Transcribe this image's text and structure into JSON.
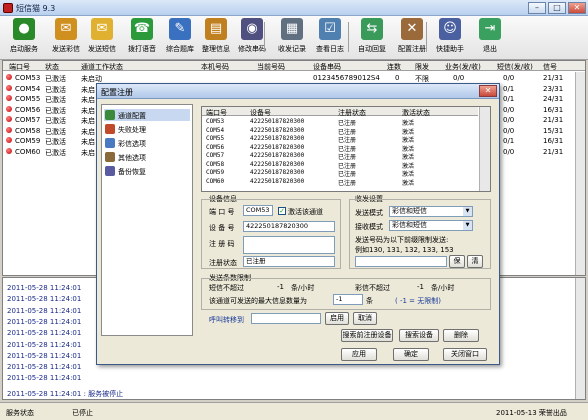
{
  "window": {
    "title": "短信猫 9.3"
  },
  "toolbar": [
    {
      "label": "启动服务",
      "icon": "traffic-light-icon",
      "color": "#2a8a2a",
      "glyph": "●"
    },
    {
      "label": "发送彩信",
      "icon": "mms-icon",
      "color": "#d09020",
      "glyph": "✉"
    },
    {
      "label": "发送短信",
      "icon": "sms-icon",
      "color": "#e0b030",
      "glyph": "✉"
    },
    {
      "label": "拨打语音",
      "icon": "phone-icon",
      "color": "#2a9a3a",
      "glyph": "☎"
    },
    {
      "label": "综合题库",
      "icon": "notebook-icon",
      "color": "#3a70c0",
      "glyph": "✎"
    },
    {
      "label": "整理信息",
      "icon": "folder-icon",
      "color": "#c08020",
      "glyph": "▤"
    },
    {
      "label": "修改串码",
      "icon": "disk-icon",
      "color": "#505080",
      "glyph": "◉"
    },
    {
      "label": "收发记录",
      "icon": "record-icon",
      "color": "#607080",
      "glyph": "▦"
    },
    {
      "label": "查看日志",
      "icon": "log-icon",
      "color": "#5080b0",
      "glyph": "☑"
    },
    {
      "label": "自动回复",
      "icon": "autoreply-icon",
      "color": "#3a9a5a",
      "glyph": "⇆"
    },
    {
      "label": "配置注册",
      "icon": "tools-icon",
      "color": "#9a6a3a",
      "glyph": "✕"
    },
    {
      "label": "快捷助手",
      "icon": "assistant-icon",
      "color": "#4a60a0",
      "glyph": "☺"
    },
    {
      "label": "退出",
      "icon": "exit-icon",
      "color": "#3aa060",
      "glyph": "⇥"
    }
  ],
  "grid": {
    "headers": [
      "端口号",
      "状态",
      "通道工作状态",
      "本机号码",
      "当前号码",
      "设备串码",
      "连数",
      "限发",
      "业务(发/收)",
      "短信(发/收)",
      "信号"
    ],
    "rows": [
      {
        "port": "COM53",
        "status": "已激活",
        "work": "未启动",
        "imei": "0123456789012S4",
        "conn": "0",
        "limit": "不限",
        "biz": "0/0",
        "sms": "0/0",
        "signal": "21/31"
      },
      {
        "port": "COM54",
        "status": "已激活",
        "work": "未启",
        "imei": "",
        "conn": "",
        "limit": "",
        "biz": "",
        "sms": "0/1",
        "signal": "23/31"
      },
      {
        "port": "COM55",
        "status": "已激活",
        "work": "未启",
        "imei": "",
        "conn": "",
        "limit": "",
        "biz": "",
        "sms": "0/1",
        "signal": "24/31"
      },
      {
        "port": "COM56",
        "status": "已激活",
        "work": "未启",
        "imei": "",
        "conn": "",
        "limit": "",
        "biz": "",
        "sms": "0/0",
        "signal": "16/31"
      },
      {
        "port": "COM57",
        "status": "已激活",
        "work": "未启",
        "imei": "",
        "conn": "",
        "limit": "",
        "biz": "",
        "sms": "0/0",
        "signal": "21/31"
      },
      {
        "port": "COM58",
        "status": "已激活",
        "work": "未启",
        "imei": "",
        "conn": "",
        "limit": "",
        "biz": "",
        "sms": "0/0",
        "signal": "15/31"
      },
      {
        "port": "COM59",
        "status": "已激活",
        "work": "未启",
        "imei": "",
        "conn": "",
        "limit": "",
        "biz": "",
        "sms": "0/1",
        "signal": "16/31"
      },
      {
        "port": "COM60",
        "status": "已激活",
        "work": "未启",
        "imei": "",
        "conn": "",
        "limit": "",
        "biz": "",
        "sms": "0/0",
        "signal": "21/31"
      }
    ]
  },
  "log": {
    "lines": [
      "2011-05-28 11:24:01",
      "2011-05-28 11:24:01",
      "2011-05-28 11:24:01",
      "2011-05-28 11:24:01",
      "2011-05-28 11:24:01",
      "2011-05-28 11:24:01",
      "2011-05-28 11:24:01",
      "2011-05-28 11:24:01",
      "2011-05-28 11:24:01"
    ],
    "last_line": "2011-05-28 11:24:01 : 服务被停止"
  },
  "statusbar": {
    "label": "服务状态",
    "state": "已停止",
    "right": "2011-05-13 荣誉出品"
  },
  "dialog": {
    "title": "配置注册",
    "close": "✕",
    "nav": [
      {
        "label": "通道配置",
        "icon": "channel-icon",
        "color": "#3a8a3a"
      },
      {
        "label": "失败处理",
        "icon": "failure-icon",
        "color": "#c04a2a"
      },
      {
        "label": "彩信选项",
        "icon": "mms-option-icon",
        "color": "#4a7ac0"
      },
      {
        "label": "其他选项",
        "icon": "other-option-icon",
        "color": "#8a6a3a"
      },
      {
        "label": "备份恢复",
        "icon": "backup-icon",
        "color": "#5a5aa0"
      }
    ],
    "channel_table": {
      "headers": [
        "端口号",
        "设备号",
        "注册状态",
        "激活状态"
      ],
      "rows": [
        {
          "port": "COM53",
          "dev": "422250187820300",
          "reg": "已注册",
          "act": "激活"
        },
        {
          "port": "COM54",
          "dev": "422250187820300",
          "reg": "已注册",
          "act": "激活"
        },
        {
          "port": "COM55",
          "dev": "422250187820300",
          "reg": "已注册",
          "act": "激活"
        },
        {
          "port": "COM56",
          "dev": "422250187820300",
          "reg": "已注册",
          "act": "激活"
        },
        {
          "port": "COM57",
          "dev": "422250187820300",
          "reg": "已注册",
          "act": "激活"
        },
        {
          "port": "COM58",
          "dev": "422250187820300",
          "reg": "已注册",
          "act": "激活"
        },
        {
          "port": "COM59",
          "dev": "422250187820300",
          "reg": "已注册",
          "act": "激活"
        },
        {
          "port": "COM60",
          "dev": "422250187820300",
          "reg": "已注册",
          "act": "激活"
        }
      ]
    },
    "device_info": {
      "legend": "设备信息",
      "port_label": "端 口 号",
      "port_value": "COM53",
      "activate_label": "激活该通道",
      "device_label": "设 备 号",
      "device_value": "422250187820300",
      "reg_code_label": "注 册 码",
      "reg_status_label": "注册状态",
      "reg_status_value": "已注册"
    },
    "send_recv": {
      "legend": "收发设置",
      "send_mode_label": "发送模式",
      "send_mode_value": "彩信和短信",
      "recv_mode_label": "接收模式",
      "recv_mode_value": "彩信和短信",
      "restrict_text": "发送号码为以下前缀限制发送:",
      "example": "例如130, 131, 132, 133, 153",
      "btn_save": "保",
      "btn_clear": "清"
    },
    "limits": {
      "legend": "发送条数限制",
      "sms_label": "短信不超过",
      "sms_value": "-1",
      "sms_unit": "条/小时",
      "mms_label": "彩信不超过",
      "mms_value": "-1",
      "mms_unit": "条/小时",
      "max_label": "该通道可发送的最大信息数量为",
      "max_value": "-1",
      "max_unit": "条",
      "max_hint": "( -1 = 无限制)"
    },
    "transfer": {
      "label": "呼叫转移到",
      "enable": "启用",
      "cancel": "取消"
    },
    "buttons": {
      "search_reg": "搜索前注册设备",
      "search_dev": "搜索设备",
      "delete": "删除",
      "apply": "应用",
      "ok": "确定",
      "close": "关闭窗口"
    }
  }
}
